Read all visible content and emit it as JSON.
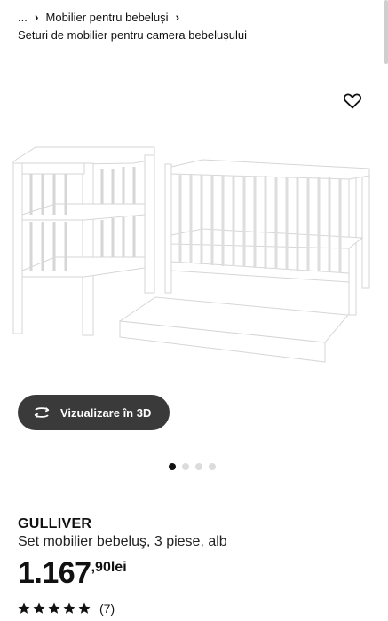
{
  "breadcrumb": {
    "ellipsis": "...",
    "category": "Mobilier pentru bebeluși",
    "subcategory": "Seturi de mobilier pentru camera bebelușului"
  },
  "gallery": {
    "view_3d_label": "Vizualizare în 3D",
    "image_count": 4,
    "active_index": 0
  },
  "product": {
    "name": "GULLIVER",
    "description": "Set mobilier bebeluş, 3 piese, alb",
    "price_integer": "1.167",
    "price_decimal": ",90",
    "currency": "lei",
    "rating_stars": 5,
    "review_count": "(7)"
  },
  "icons": {
    "favorite": "heart-outline-icon",
    "view_3d": "rotate-3d-icon",
    "breadcrumb_separator": "chevron-right-icon",
    "rating": "star-icon"
  },
  "colors": {
    "button_3d_bg": "#3a3a3a",
    "text": "#111111",
    "dot_active": "#111111",
    "dot_inactive": "#dcdcdc"
  }
}
